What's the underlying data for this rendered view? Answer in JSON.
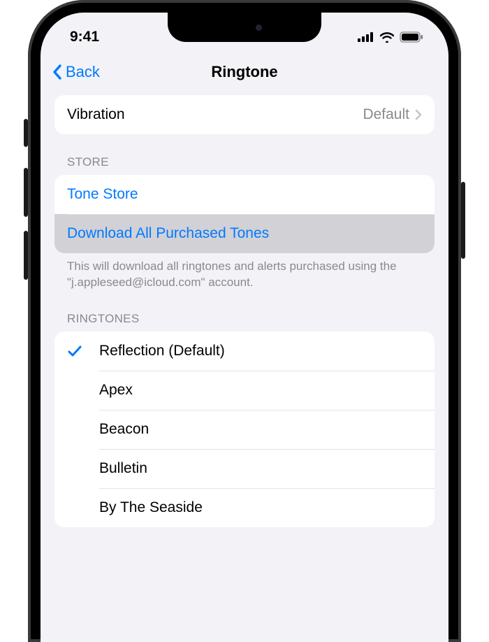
{
  "status": {
    "time": "9:41"
  },
  "nav": {
    "back_label": "Back",
    "title": "Ringtone"
  },
  "vibration": {
    "label": "Vibration",
    "value": "Default"
  },
  "store": {
    "header": "Store",
    "tone_store": "Tone Store",
    "download_all": "Download All Purchased Tones",
    "footer": "This will download all ringtones and alerts purchased using the \"j.appleseed@icloud.com\" account."
  },
  "ringtones": {
    "header": "Ringtones",
    "items": [
      {
        "label": "Reflection (Default)",
        "selected": true
      },
      {
        "label": "Apex",
        "selected": false
      },
      {
        "label": "Beacon",
        "selected": false
      },
      {
        "label": "Bulletin",
        "selected": false
      },
      {
        "label": "By The Seaside",
        "selected": false
      }
    ]
  }
}
